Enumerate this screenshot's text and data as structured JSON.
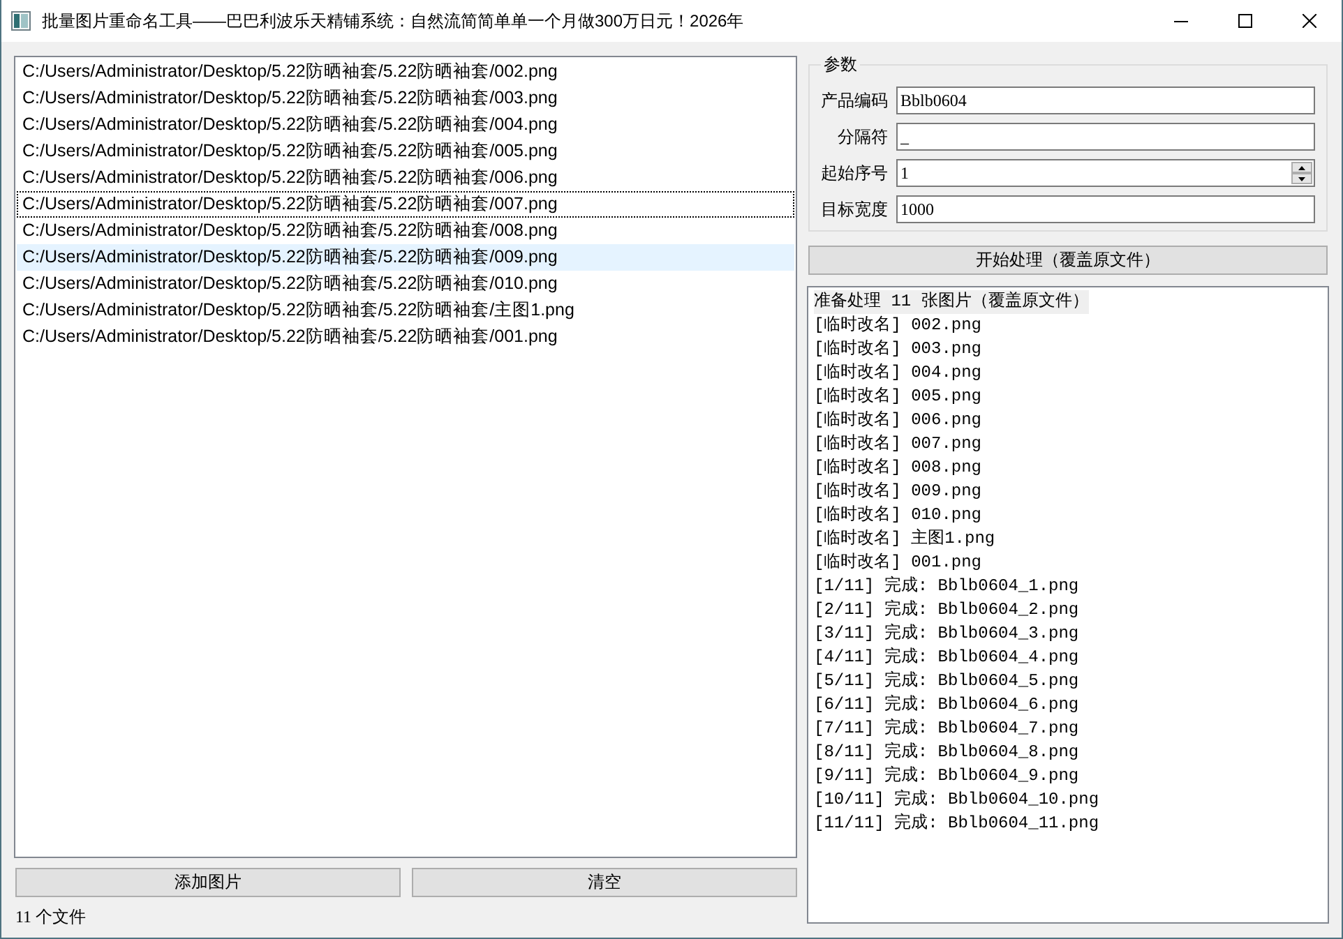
{
  "window": {
    "title": "批量图片重命名工具——巴巴利波乐天精铺系统：自然流简简单单一个月做300万日元！2026年"
  },
  "file_list": {
    "items": [
      {
        "path": "C:/Users/Administrator/Desktop/5.22防晒袖套/5.22防晒袖套/002.png",
        "selected": false,
        "focused": false
      },
      {
        "path": "C:/Users/Administrator/Desktop/5.22防晒袖套/5.22防晒袖套/003.png",
        "selected": false,
        "focused": false
      },
      {
        "path": "C:/Users/Administrator/Desktop/5.22防晒袖套/5.22防晒袖套/004.png",
        "selected": false,
        "focused": false
      },
      {
        "path": "C:/Users/Administrator/Desktop/5.22防晒袖套/5.22防晒袖套/005.png",
        "selected": false,
        "focused": false
      },
      {
        "path": "C:/Users/Administrator/Desktop/5.22防晒袖套/5.22防晒袖套/006.png",
        "selected": false,
        "focused": false
      },
      {
        "path": "C:/Users/Administrator/Desktop/5.22防晒袖套/5.22防晒袖套/007.png",
        "selected": false,
        "focused": true
      },
      {
        "path": "C:/Users/Administrator/Desktop/5.22防晒袖套/5.22防晒袖套/008.png",
        "selected": false,
        "focused": false
      },
      {
        "path": "C:/Users/Administrator/Desktop/5.22防晒袖套/5.22防晒袖套/009.png",
        "selected": true,
        "focused": false
      },
      {
        "path": "C:/Users/Administrator/Desktop/5.22防晒袖套/5.22防晒袖套/010.png",
        "selected": false,
        "focused": false
      },
      {
        "path": "C:/Users/Administrator/Desktop/5.22防晒袖套/5.22防晒袖套/主图1.png",
        "selected": false,
        "focused": false
      },
      {
        "path": "C:/Users/Administrator/Desktop/5.22防晒袖套/5.22防晒袖套/001.png",
        "selected": false,
        "focused": false
      }
    ]
  },
  "add_button": {
    "label": "添加图片"
  },
  "clear_button": {
    "label": "清空"
  },
  "status": "11 个文件",
  "params": {
    "title": "参数",
    "fields": [
      {
        "label": "产品编码",
        "value": "Bblb0604",
        "kind": "text"
      },
      {
        "label": "分隔符",
        "value": "_",
        "kind": "text"
      },
      {
        "label": "起始序号",
        "value": "1",
        "kind": "spin"
      },
      {
        "label": "目标宽度",
        "value": "1000",
        "kind": "text"
      }
    ]
  },
  "start_button": {
    "label": "开始处理（覆盖原文件）"
  },
  "log": {
    "lines": [
      {
        "text": "准备处理 11 张图片（覆盖原文件）",
        "highlighted": true
      },
      {
        "text": "[临时改名] 002.png",
        "highlighted": false
      },
      {
        "text": "[临时改名] 003.png",
        "highlighted": false
      },
      {
        "text": "[临时改名] 004.png",
        "highlighted": false
      },
      {
        "text": "[临时改名] 005.png",
        "highlighted": false
      },
      {
        "text": "[临时改名] 006.png",
        "highlighted": false
      },
      {
        "text": "[临时改名] 007.png",
        "highlighted": false
      },
      {
        "text": "[临时改名] 008.png",
        "highlighted": false
      },
      {
        "text": "[临时改名] 009.png",
        "highlighted": false
      },
      {
        "text": "[临时改名] 010.png",
        "highlighted": false
      },
      {
        "text": "[临时改名] 主图1.png",
        "highlighted": false
      },
      {
        "text": "[临时改名] 001.png",
        "highlighted": false
      },
      {
        "text": "[1/11] 完成: Bblb0604_1.png",
        "highlighted": false
      },
      {
        "text": "[2/11] 完成: Bblb0604_2.png",
        "highlighted": false
      },
      {
        "text": "[3/11] 完成: Bblb0604_3.png",
        "highlighted": false
      },
      {
        "text": "[4/11] 完成: Bblb0604_4.png",
        "highlighted": false
      },
      {
        "text": "[5/11] 完成: Bblb0604_5.png",
        "highlighted": false
      },
      {
        "text": "[6/11] 完成: Bblb0604_6.png",
        "highlighted": false
      },
      {
        "text": "[7/11] 完成: Bblb0604_7.png",
        "highlighted": false
      },
      {
        "text": "[8/11] 完成: Bblb0604_8.png",
        "highlighted": false
      },
      {
        "text": "[9/11] 完成: Bblb0604_9.png",
        "highlighted": false
      },
      {
        "text": "[10/11] 完成: Bblb0604_10.png",
        "highlighted": false
      },
      {
        "text": "[11/11] 完成: Bblb0604_11.png",
        "highlighted": false
      }
    ]
  }
}
